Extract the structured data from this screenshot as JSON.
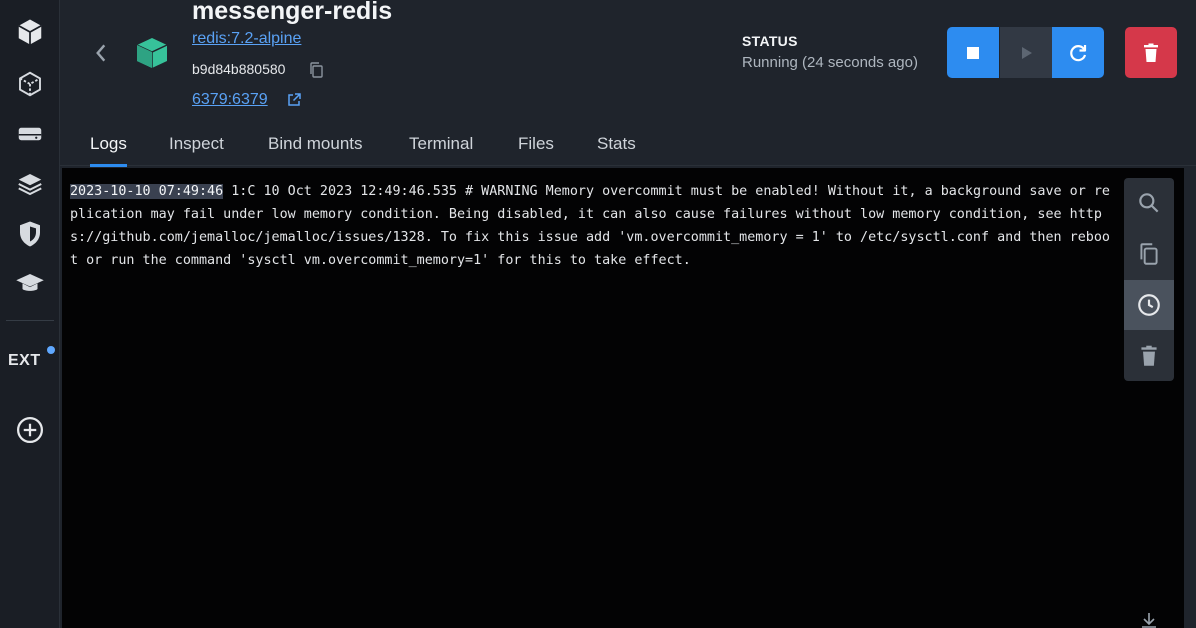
{
  "rail": {
    "items": [
      {
        "name": "containers-icon"
      },
      {
        "name": "images-icon"
      },
      {
        "name": "volumes-icon"
      },
      {
        "name": "builds-icon"
      },
      {
        "name": "scout-icon"
      },
      {
        "name": "learning-icon"
      }
    ],
    "ext_label": "EXT"
  },
  "header": {
    "title": "messenger-redis",
    "image": "redis:7.2-alpine",
    "container_id": "b9d84b880580",
    "port": "6379:6379",
    "status_label": "STATUS",
    "status_value": "Running (24 seconds ago)"
  },
  "tabs": [
    {
      "label": "Logs",
      "active": true
    },
    {
      "label": "Inspect"
    },
    {
      "label": "Bind mounts"
    },
    {
      "label": "Terminal"
    },
    {
      "label": "Files"
    },
    {
      "label": "Stats"
    }
  ],
  "logs": {
    "timestamp": "2023-10-10 07:49:46",
    "message": " 1:C 10 Oct 2023 12:49:46.535 # WARNING Memory overcommit must be enabled! Without it, a background save or replication may fail under low memory condition. Being disabled, it can also cause failures without low memory condition, see https://github.com/jemalloc/jemalloc/issues/1328. To fix this issue add 'vm.overcommit_memory = 1' to /etc/sysctl.conf and then reboot or run the command 'sysctl vm.overcommit_memory=1' for this to take effect."
  },
  "colors": {
    "accent": "#2d8cf0",
    "danger": "#d5384a",
    "container_icon": "#37c29a"
  }
}
